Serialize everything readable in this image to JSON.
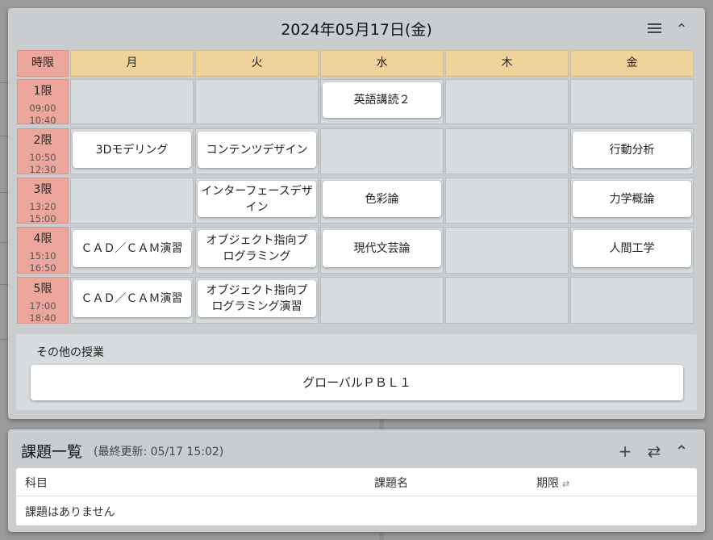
{
  "timetable": {
    "date": "2024年05月17日(金)",
    "corner_label": "時限",
    "days": [
      "月",
      "火",
      "水",
      "木",
      "金"
    ],
    "periods": [
      {
        "label": "1限",
        "start": "09:00",
        "end": "10:40"
      },
      {
        "label": "2限",
        "start": "10:50",
        "end": "12:30"
      },
      {
        "label": "3限",
        "start": "13:20",
        "end": "15:00"
      },
      {
        "label": "4限",
        "start": "15:10",
        "end": "16:50"
      },
      {
        "label": "5限",
        "start": "17:00",
        "end": "18:40"
      }
    ],
    "courses": [
      [
        "",
        "",
        "英語講読２",
        "",
        ""
      ],
      [
        "3Dモデリング",
        "コンテンツデザイン",
        "",
        "",
        "行動分析"
      ],
      [
        "",
        "インターフェースデザイン",
        "色彩論",
        "",
        "力学概論"
      ],
      [
        "ＣＡＤ／ＣＡＭ演習",
        "オブジェクト指向プログラミング",
        "現代文芸論",
        "",
        "人間工学"
      ],
      [
        "ＣＡＤ／ＣＡＭ演習",
        "オブジェクト指向プログラミング演習",
        "",
        "",
        ""
      ]
    ],
    "other_label": "その他の授業",
    "other_courses": [
      "グローバルＰＢＬ１"
    ]
  },
  "tasks": {
    "title": "課題一覧",
    "last_updated": "(最終更新: 05/17 15:02)",
    "columns": [
      "科目",
      "課題名",
      "期限"
    ],
    "empty_message": "課題はありません"
  },
  "colors": {
    "header_day": "#f0d29b",
    "header_period": "#eda69b",
    "cell_empty": "#d7dcde",
    "panel": "#c9cdcf"
  }
}
